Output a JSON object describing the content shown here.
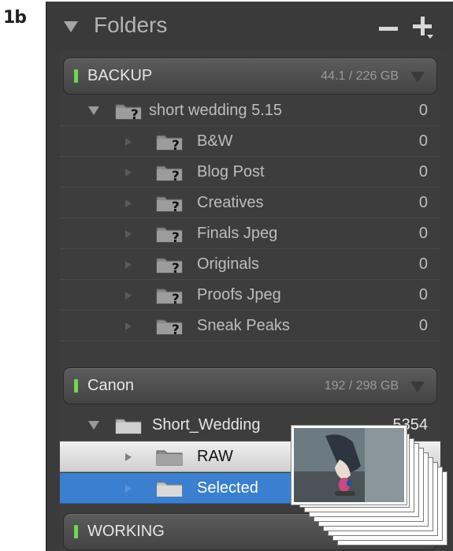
{
  "figure_label": "1b",
  "panel": {
    "title": "Folders",
    "remove_icon": "minus-icon",
    "add_icon": "plus-dropdown-icon"
  },
  "volumes": [
    {
      "name": "BACKUP",
      "size": "44.1 / 226 GB",
      "status_color": "#6fd94d"
    },
    {
      "name": "Canon",
      "size": "192 / 298 GB",
      "status_color": "#6fd94d"
    },
    {
      "name": "WORKING",
      "size": "",
      "status_color": "#6fd94d"
    }
  ],
  "backup_folders": {
    "parent": {
      "name": "short wedding 5.15",
      "count": "0",
      "missing": true
    },
    "children": [
      {
        "name": "B&W",
        "count": "0"
      },
      {
        "name": "Blog Post",
        "count": "0"
      },
      {
        "name": "Creatives",
        "count": "0"
      },
      {
        "name": "Finals Jpeg",
        "count": "0"
      },
      {
        "name": "Originals",
        "count": "0"
      },
      {
        "name": "Proofs Jpeg",
        "count": "0"
      },
      {
        "name": "Sneak Peaks",
        "count": "0"
      }
    ]
  },
  "canon_folders": {
    "parent": {
      "name": "Short_Wedding",
      "count": "5354"
    },
    "children": [
      {
        "name": "RAW",
        "count": "",
        "state": "hover"
      },
      {
        "name": "Selected",
        "count": "",
        "state": "selected"
      }
    ]
  },
  "colors": {
    "panel_bg": "#3b3b3b",
    "selected_row": "#3a7fd0",
    "status_led": "#6fd94d"
  },
  "drag_preview": {
    "icon": "photo-stack-drag-icon"
  }
}
